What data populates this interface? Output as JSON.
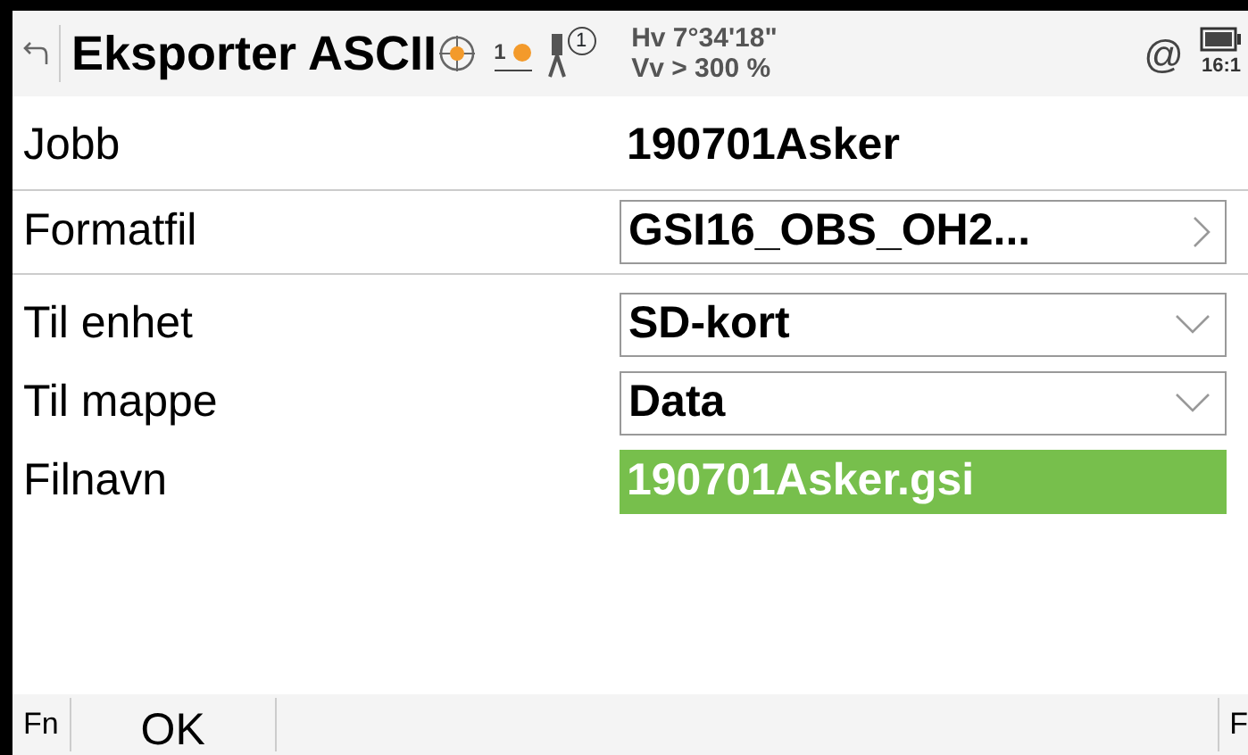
{
  "header": {
    "title": "Eksporter ASCII",
    "prism": "1",
    "instrument": "1",
    "hz": "Hv 7°34'18\"",
    "v": "Vv > 300 %",
    "at": "@",
    "time": "16:1"
  },
  "fields": [
    {
      "label": "Jobb",
      "value": "190701Asker",
      "kind": "text"
    },
    {
      "label": "Formatfil",
      "value": "GSI16_OBS_OH2...",
      "kind": "list"
    },
    {
      "label": "Til enhet",
      "value": "SD-kort",
      "kind": "dropdown"
    },
    {
      "label": "Til mappe",
      "value": "Data",
      "kind": "dropdown"
    },
    {
      "label": "Filnavn",
      "value": "190701Asker.gsi",
      "kind": "input",
      "selected": true
    }
  ],
  "softkeys": {
    "left": "Fn",
    "ok": "OK",
    "right": "F"
  }
}
